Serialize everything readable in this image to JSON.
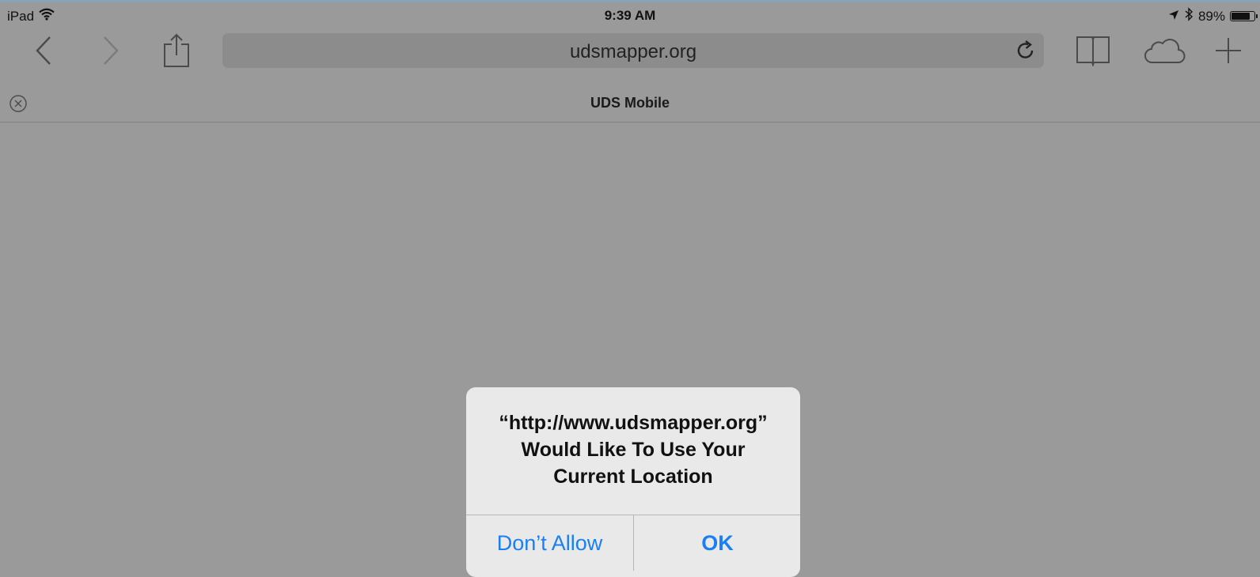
{
  "status_bar": {
    "device": "iPad",
    "time": "9:39 AM",
    "battery_percent": "89%",
    "battery_level": 0.89,
    "icons": [
      "wifi-icon",
      "location-arrow-icon",
      "bluetooth-icon",
      "battery-icon"
    ]
  },
  "toolbar": {
    "url": "udsmapper.org",
    "icons": [
      "back-icon",
      "forward-icon",
      "share-icon",
      "reload-icon",
      "bookmarks-icon",
      "icloud-tabs-icon",
      "new-tab-icon"
    ]
  },
  "tab": {
    "title": "UDS Mobile",
    "close_icon": "close-circle-icon"
  },
  "alert": {
    "message_line1": "“http://www.udsmapper.org”",
    "message_line2": "Would Like To Use Your",
    "message_line3": "Current Location",
    "dont_allow_label": "Don’t Allow",
    "ok_label": "OK"
  },
  "colors": {
    "overlay_background": "#9a9a9a",
    "alert_background": "#e9e9e9",
    "button_blue": "#1a7ff5"
  }
}
